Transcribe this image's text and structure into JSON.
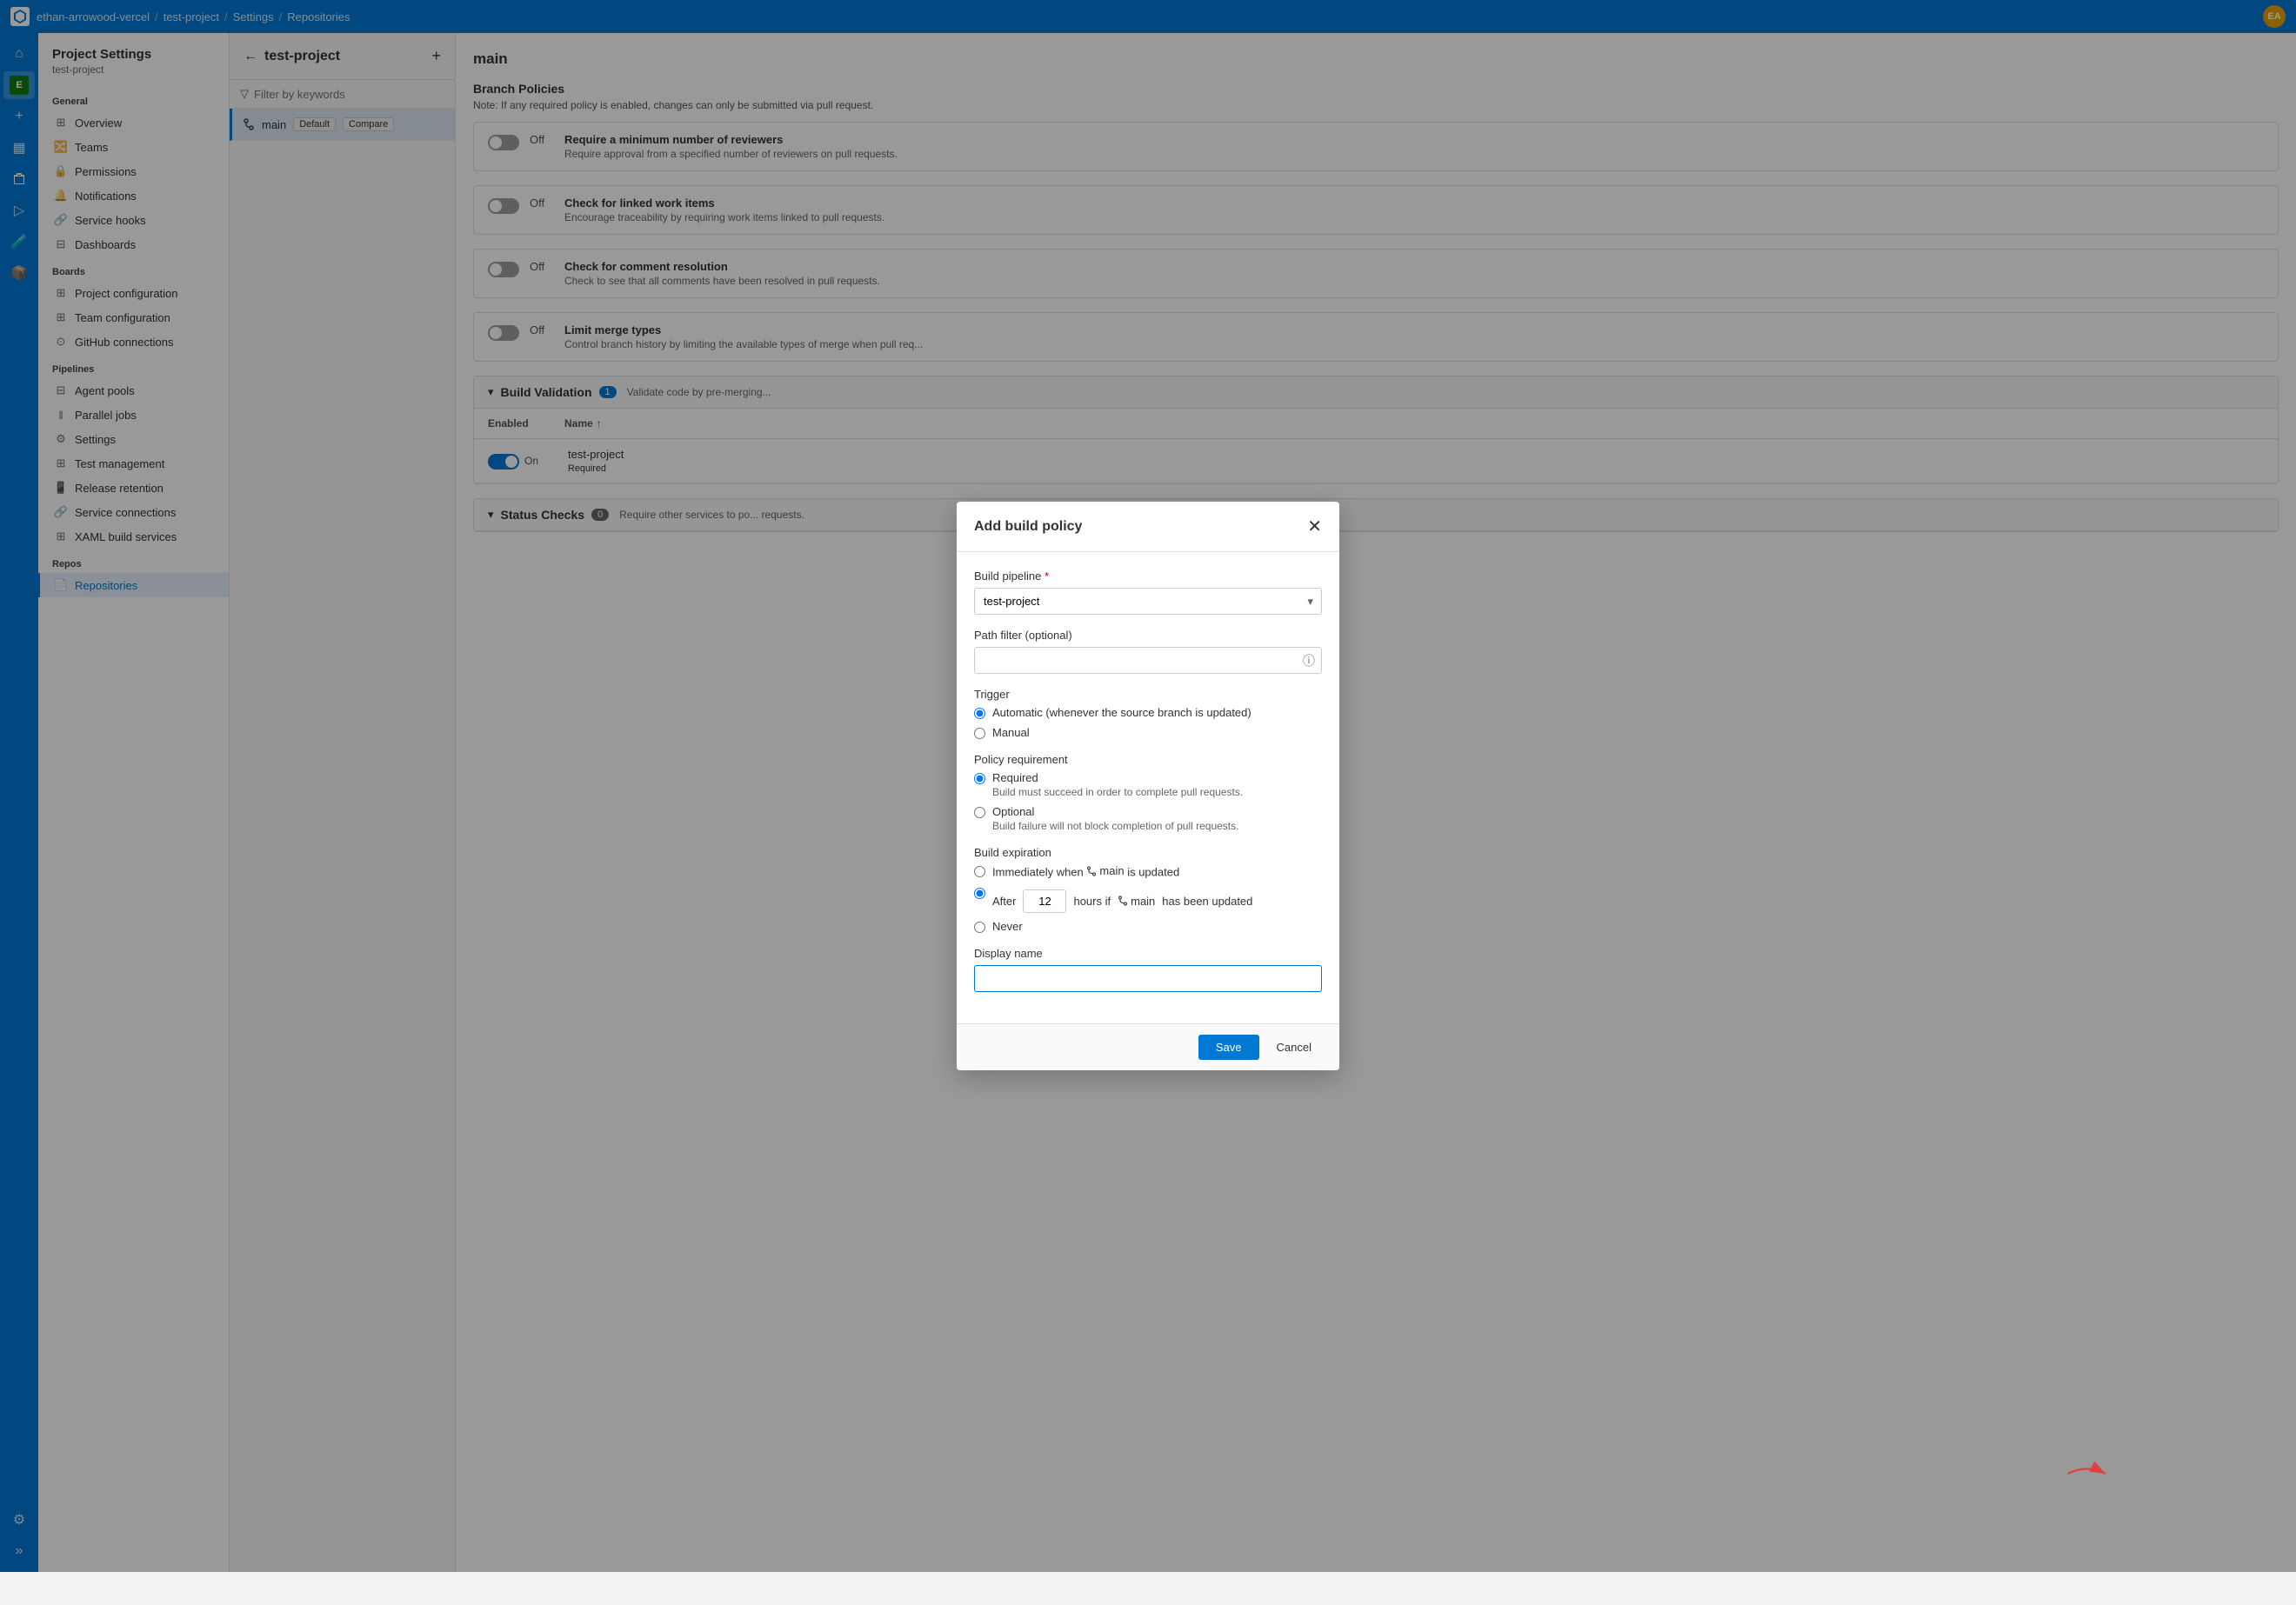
{
  "topNav": {
    "breadcrumb": [
      "ethan-arrowood-vercel",
      "test-project",
      "Settings",
      "Repositories"
    ],
    "separators": [
      "/",
      "/",
      "/"
    ]
  },
  "iconSidebar": {
    "items": [
      {
        "name": "home-icon",
        "symbol": "⌂"
      },
      {
        "name": "user-icon",
        "symbol": "👤"
      },
      {
        "name": "plus-icon",
        "symbol": "+"
      },
      {
        "name": "board-icon",
        "symbol": "▦"
      },
      {
        "name": "repo-icon",
        "symbol": "⬡"
      },
      {
        "name": "pipelines-icon",
        "symbol": "▷"
      },
      {
        "name": "test-icon",
        "symbol": "🧪"
      },
      {
        "name": "artifacts-icon",
        "symbol": "📦"
      },
      {
        "name": "settings-icon",
        "symbol": "⚙"
      },
      {
        "name": "expand-icon",
        "symbol": "»"
      }
    ]
  },
  "settingsNav": {
    "title": "Project Settings",
    "subtitle": "test-project",
    "sections": [
      {
        "title": "General",
        "items": [
          {
            "label": "Overview",
            "icon": "grid-icon"
          },
          {
            "label": "Teams",
            "icon": "teams-icon"
          },
          {
            "label": "Permissions",
            "icon": "lock-icon"
          },
          {
            "label": "Notifications",
            "icon": "bell-icon"
          },
          {
            "label": "Service hooks",
            "icon": "hook-icon"
          },
          {
            "label": "Dashboards",
            "icon": "dashboard-icon"
          }
        ]
      },
      {
        "title": "Boards",
        "items": [
          {
            "label": "Project configuration",
            "icon": "config-icon"
          },
          {
            "label": "Team configuration",
            "icon": "team-config-icon"
          },
          {
            "label": "GitHub connections",
            "icon": "github-icon"
          }
        ]
      },
      {
        "title": "Pipelines",
        "items": [
          {
            "label": "Agent pools",
            "icon": "agent-icon"
          },
          {
            "label": "Parallel jobs",
            "icon": "parallel-icon"
          },
          {
            "label": "Settings",
            "icon": "settings-icon"
          },
          {
            "label": "Test management",
            "icon": "test-icon"
          },
          {
            "label": "Release retention",
            "icon": "retention-icon"
          },
          {
            "label": "Service connections",
            "icon": "service-icon"
          },
          {
            "label": "XAML build services",
            "icon": "xaml-icon"
          }
        ]
      },
      {
        "title": "Repos",
        "items": [
          {
            "label": "Repositories",
            "icon": "repo-icon",
            "active": true
          }
        ]
      }
    ]
  },
  "middlePanel": {
    "title": "test-project",
    "filterPlaceholder": "Filter by keywords",
    "branches": [
      {
        "name": "main",
        "isDefault": true,
        "badge": "Default",
        "compare": "Compare",
        "active": true
      }
    ]
  },
  "mainContent": {
    "title": "main",
    "sectionTitle": "Branch Policies",
    "note": "Note: If any required policy is enabled, changes can only be submitted via pull request.",
    "policies": [
      {
        "toggle": false,
        "label": "Off",
        "title": "Require a minimum number of reviewers",
        "desc": "Require approval from a specified number of reviewers on pull requests."
      },
      {
        "toggle": false,
        "label": "Off",
        "title": "Check for linked work items",
        "desc": "Encourage traceability by requiring work items linked to pull requests."
      },
      {
        "toggle": false,
        "label": "Off",
        "title": "Check for comment resolution",
        "desc": "Check to see that all comments have been resolved in pull requests."
      },
      {
        "toggle": false,
        "label": "Off",
        "title": "Limit merge types",
        "desc": "Control branch history by limiting the available types of merge when pull req..."
      }
    ],
    "buildValidation": {
      "title": "Build Validation",
      "badge": "1",
      "desc": "Validate code by pre-merging...",
      "colEnabled": "Enabled",
      "colName": "Name",
      "rows": [
        {
          "enabled": true,
          "status": "On",
          "name": "test-project",
          "requirement": "Required"
        }
      ]
    },
    "statusChecks": {
      "title": "Status Checks",
      "badge": "0",
      "desc": "Require other services to po... requests."
    }
  },
  "modal": {
    "title": "Add build policy",
    "closeLabel": "✕",
    "buildPipelineLabel": "Build pipeline",
    "buildPipelineRequired": "*",
    "buildPipelineValue": "test-project",
    "pathFilterLabel": "Path filter (optional)",
    "pathFilterPlaceholder": "",
    "triggerLabel": "Trigger",
    "triggerOptions": [
      {
        "label": "Automatic (whenever the source branch is updated)",
        "value": "automatic",
        "checked": true
      },
      {
        "label": "Manual",
        "value": "manual",
        "checked": false
      }
    ],
    "policyRequirementLabel": "Policy requirement",
    "policyRequirementOptions": [
      {
        "label": "Required",
        "value": "required",
        "checked": true,
        "desc": "Build must succeed in order to complete pull requests."
      },
      {
        "label": "Optional",
        "value": "optional",
        "checked": false,
        "desc": "Build failure will not block completion of pull requests."
      }
    ],
    "buildExpirationLabel": "Build expiration",
    "buildExpirationOptions": [
      {
        "label": "Immediately when",
        "branchRef": "main",
        "suffix": "is updated",
        "value": "immediately",
        "checked": false
      },
      {
        "label": "After",
        "hours": "12",
        "hoursLabel": "hours if",
        "branchRef": "main",
        "suffix": "has been updated",
        "value": "after",
        "checked": true
      },
      {
        "label": "Never",
        "value": "never",
        "checked": false
      }
    ],
    "displayNameLabel": "Display name",
    "displayNameValue": "",
    "saveLabel": "Save",
    "cancelLabel": "Cancel"
  }
}
